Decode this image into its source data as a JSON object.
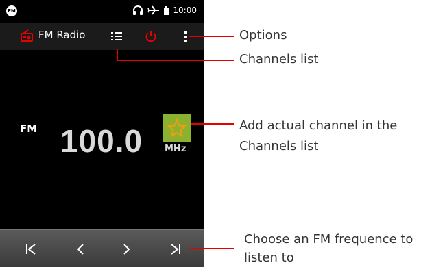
{
  "status_bar": {
    "fm_icon_label": "FM",
    "time": "10:00",
    "icons": [
      "headphones-icon",
      "airplane-mode-icon",
      "battery-icon"
    ]
  },
  "action_bar": {
    "title": "FM Radio",
    "icons": [
      "radio-app-icon",
      "channels-list-icon",
      "power-icon",
      "overflow-menu-icon"
    ],
    "accent_color": "#e60000"
  },
  "tuner": {
    "band": "FM",
    "frequency": "100.0",
    "unit": "MHz",
    "favorite_icon": "star-icon",
    "favorite_bg": "#8ab22e"
  },
  "controls": {
    "icons": [
      "seek-previous-icon",
      "step-back-icon",
      "step-forward-icon",
      "seek-next-icon"
    ]
  },
  "annotations": {
    "options": "Options",
    "channels_list": "Channels list",
    "add_channel_line1": "Add actual channel in the",
    "add_channel_line2": "Channels list",
    "choose_freq_line1": "Choose an FM frequence to",
    "choose_freq_line2": "listen to"
  }
}
